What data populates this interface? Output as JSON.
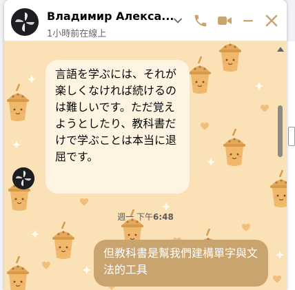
{
  "header": {
    "name": "Владимир Алекса...",
    "status": "1小時前在線上"
  },
  "messages": {
    "incoming": "言語を学ぶには、それが楽しくなければ続けるのは難しいです。ただ覚えようとしたり、教科書だけで学ぶことは本当に退屈です。",
    "timestamp_day": "週一 下午",
    "timestamp_time": "6:48",
    "outgoing": "但教科書是幫我們建構單字與文法的工具"
  },
  "colors": {
    "theme_background": "#fbe1b6",
    "incoming_bubble": "#fff4e2",
    "outgoing_bubble": "#c9a46e",
    "pattern_character": "#e2a85c",
    "pattern_heart": "#f0c07a",
    "pattern_star": "#ffffff"
  },
  "icons": {
    "chevron": "chevron-down-icon",
    "call": "phone-icon",
    "video": "video-icon",
    "minimize": "minimize-icon",
    "close": "close-icon"
  },
  "page_side_tag": "iz"
}
